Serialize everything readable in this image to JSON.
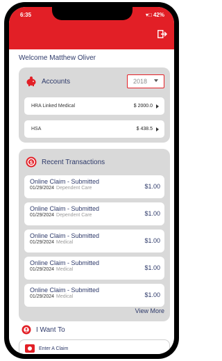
{
  "status": {
    "time": "6:35",
    "right": "42%"
  },
  "header": {
    "welcome": "Welcome Matthew Oliver"
  },
  "accounts": {
    "title": "Accounts",
    "year": "2018",
    "items": [
      {
        "name": "HRA Linked Medical",
        "amount": "$ 2000.0"
      },
      {
        "name": "HSA",
        "amount": "$ 438.5"
      }
    ]
  },
  "transactions": {
    "title": "Recent Transactions",
    "items": [
      {
        "title": "Online Claim  - Submitted",
        "date": "01/29/2024",
        "category": "Dependent Care",
        "amount": "$1.00"
      },
      {
        "title": "Online Claim  - Submitted",
        "date": "01/29/2024",
        "category": "Dependent Care",
        "amount": "$1.00"
      },
      {
        "title": "Online Claim  - Submitted",
        "date": "01/29/2024",
        "category": "Medical",
        "amount": "$1.00"
      },
      {
        "title": "Online Claim  - Submitted",
        "date": "01/29/2024",
        "category": "Medical",
        "amount": "$1.00"
      },
      {
        "title": "Online Claim  - Submitted",
        "date": "01/29/2024",
        "category": "Medical",
        "amount": "$1.00"
      }
    ],
    "view_more": "View More"
  },
  "i_want_to": {
    "title": "I Want To",
    "first_action": "Enter A Claim"
  },
  "colors": {
    "brand": "#e21f26",
    "text": "#2e3a6a",
    "card": "#d9d9d9"
  }
}
